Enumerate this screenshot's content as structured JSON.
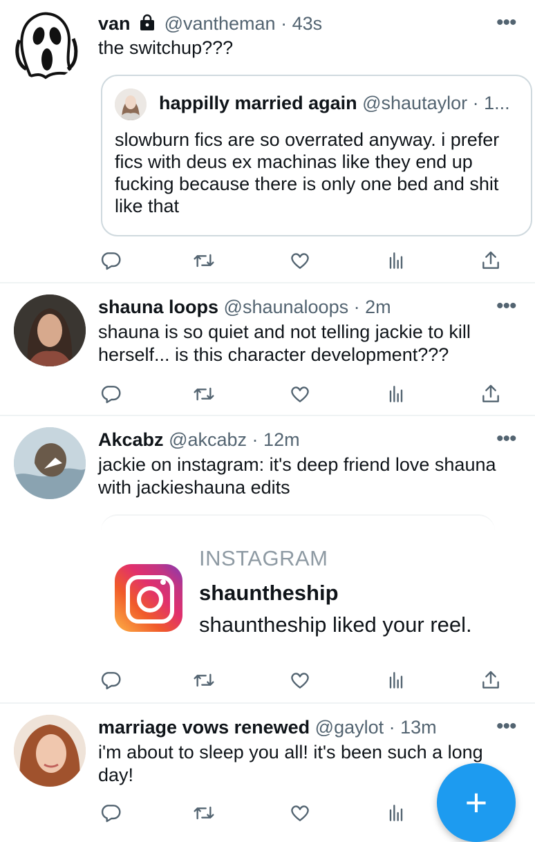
{
  "tweets": [
    {
      "name": "van",
      "handle": "@vantheman",
      "time": "43s",
      "text": "the switchup???",
      "avatar_icon": "ghostface-mask",
      "locked": true,
      "quote": {
        "name": "happilly married again",
        "handle_time": "@shautaylor · 1...",
        "text": "slowburn fics are so overrated anyway. i prefer fics with deus ex machinas like they end up fucking because there is only one bed and shit like that"
      }
    },
    {
      "name": "shauna loops",
      "handle": "@shaunaloops",
      "time": "2m",
      "text": "shauna is so quiet and not telling jackie to kill herself... is this character development???",
      "avatar_icon": "profile-photo"
    },
    {
      "name": "Akcabz",
      "handle": "@akcabz",
      "time": "12m",
      "text": "jackie on instagram: it's deep friend love shauna with jackieshauna edits",
      "avatar_icon": "profile-photo",
      "card": {
        "source": "INSTAGRAM",
        "title": "shauntheship",
        "body": "shauntheship liked your reel."
      }
    },
    {
      "name": "marriage vows renewed",
      "handle": "@gaylot",
      "time": "13m",
      "text": "i'm about to sleep you all! it's been such a long day!",
      "avatar_icon": "profile-photo"
    }
  ],
  "fab": {
    "label": "+",
    "icon": "compose-plus-icon",
    "color": "#1d9bf0"
  },
  "colors": {
    "primary_text": "#0f1419",
    "secondary_text": "#536471",
    "divider": "#eff3f4",
    "accent": "#1d9bf0"
  }
}
